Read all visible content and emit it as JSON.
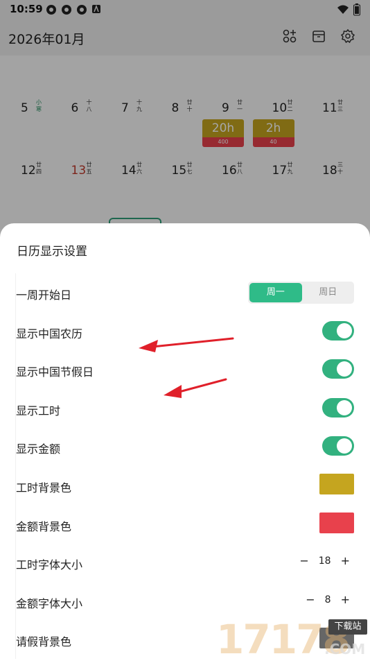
{
  "status_bar": {
    "time": "10:59"
  },
  "header": {
    "month": "2026年01月"
  },
  "calendar": {
    "rows": [
      [
        {
          "num": "5",
          "lunar": "小寒",
          "num_red": false,
          "lunar_green": true
        },
        {
          "num": "6",
          "lunar": "十八"
        },
        {
          "num": "7",
          "lunar": "十九"
        },
        {
          "num": "8",
          "lunar": "廿十"
        },
        {
          "num": "9",
          "lunar": "廿一",
          "hours": "20h",
          "amount": "400"
        },
        {
          "num": "10",
          "lunar": "廿二",
          "hours": "2h",
          "amount": "40"
        },
        {
          "num": "11",
          "lunar": "廿三"
        }
      ],
      [
        {
          "num": "12",
          "lunar": "廿四"
        },
        {
          "num": "13",
          "lunar": "廿五",
          "num_red": true
        },
        {
          "num": "14",
          "lunar": "廿六"
        },
        {
          "num": "15",
          "lunar": "廿七"
        },
        {
          "num": "16",
          "lunar": "廿八"
        },
        {
          "num": "17",
          "lunar": "廿九"
        },
        {
          "num": "18",
          "lunar": "三十"
        }
      ]
    ]
  },
  "sheet": {
    "title": "日历显示设置",
    "week_start": {
      "label": "一周开始日",
      "options": [
        "周一",
        "周日"
      ],
      "selected": "周一"
    },
    "show_lunar": {
      "label": "显示中国农历",
      "on": true
    },
    "show_holidays": {
      "label": "显示中国节假日",
      "on": true
    },
    "show_hours": {
      "label": "显示工时",
      "on": true
    },
    "show_amount": {
      "label": "显示金额",
      "on": true
    },
    "hours_bg": {
      "label": "工时背景色",
      "color": "#c5a51f"
    },
    "amount_bg": {
      "label": "金额背景色",
      "color": "#e8414c"
    },
    "hours_font": {
      "label": "工时字体大小",
      "value": "18",
      "minus": "−",
      "plus": "+"
    },
    "amount_font": {
      "label": "金额字体大小",
      "value": "8",
      "minus": "−",
      "plus": "+"
    },
    "leave_bg": {
      "label": "请假背景色"
    }
  },
  "watermark": {
    "text": "17178",
    "tag": "下载站",
    "suffix": ".COM"
  },
  "colors": {
    "accent": "#32b17f",
    "arrow": "#e0202a"
  }
}
